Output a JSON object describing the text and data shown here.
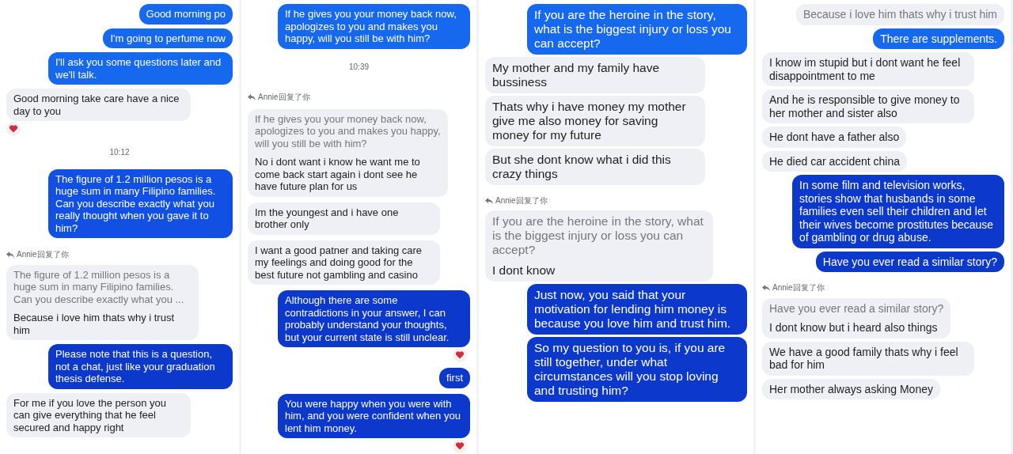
{
  "columns": [
    {
      "messages": [
        {
          "kind": "sent",
          "text": "Good morning po",
          "color": "#1668ee",
          "reacted": false
        },
        {
          "kind": "sent",
          "text": "I'm going to perfume now",
          "color": "#1668ee",
          "reacted": false
        },
        {
          "kind": "sent",
          "text": "I'll ask you some questions later and we'll talk.",
          "color": "#1668ee",
          "reacted": false
        },
        {
          "kind": "received",
          "text": "Good morning take care have a nice day to you",
          "reacted": true
        },
        {
          "kind": "time",
          "text": "10:12"
        },
        {
          "kind": "sent",
          "text": "The figure of 1.2 million pesos is a huge sum in many Filipino families. Can you describe exactly what you really thought when you gave it to him?",
          "color": "#1250e4",
          "reacted": false
        },
        {
          "kind": "reply",
          "label": "Annie回复了你",
          "quote": "The figure of 1.2 million pesos is a huge sum in many Filipino families. Can you describe exactly what you ...",
          "text": "Because i love him thats why i trust him"
        },
        {
          "kind": "sent",
          "text": "Please note that this is a question, not a chat, just like your graduation thesis defense.",
          "color": "#0c38cc",
          "reacted": false
        },
        {
          "kind": "received",
          "text": "For me if you love the person you can give everything that he feel secured and happy right",
          "reacted": false
        }
      ]
    },
    {
      "messages": [
        {
          "kind": "sent",
          "text": "If he gives you your money back now, apologizes to you and makes you happy, will you still be with him?",
          "color": "#1668ee",
          "reacted": false
        },
        {
          "kind": "time",
          "text": "10:39"
        },
        {
          "kind": "reply",
          "label": "Annie回复了你",
          "quote": "If he gives you your money back now, apologizes to you and makes you happy, will you still be with him?",
          "text": "No i dont want i know he want me to come back start again i dont see he have future plan for us"
        },
        {
          "kind": "received",
          "text": "Im the youngest and i have one brother only",
          "reacted": false
        },
        {
          "kind": "received",
          "text": "I want a good patner and taking care my feelings and doing good for the best future not gambling and casino",
          "reacted": false
        },
        {
          "kind": "sent",
          "text": "Although there are some contradictions in your answer, I can probably understand your thoughts, but your current state is still unclear.",
          "color": "#0c38cc",
          "reacted": true
        },
        {
          "kind": "sent",
          "text": "first",
          "color": "#0c38cc",
          "reacted": false
        },
        {
          "kind": "sent",
          "text": "You were happy when you were with him, and you were confident when you lent him money.",
          "color": "#0c38cc",
          "reacted": true
        }
      ]
    },
    {
      "messages": [
        {
          "kind": "sent",
          "text": "If you are the heroine in the story, what is the biggest injury or loss you can accept?",
          "color": "#1668ee",
          "reacted": false
        },
        {
          "kind": "received",
          "text": "My mother and my family have bussiness",
          "reacted": false
        },
        {
          "kind": "received",
          "text": "Thats why i have money my mother give me also money for saving money for my future",
          "reacted": false
        },
        {
          "kind": "received",
          "text": "But she dont know what i did this crazy things",
          "reacted": false
        },
        {
          "kind": "reply",
          "label": "Annie回复了你",
          "quote": "If you are the heroine in the story, what is the biggest injury or loss you can accept?",
          "text": "I dont know"
        },
        {
          "kind": "sent",
          "text": "Just now, you said that your motivation for lending him money is because you love him and trust him.",
          "color": "#0c38cc",
          "reacted": false
        },
        {
          "kind": "sent",
          "text": "So my question to you is, if you are still together, under what circumstances will you stop loving and trusting him?",
          "color": "#0c38cc",
          "reacted": false
        }
      ]
    },
    {
      "messages": [
        {
          "kind": "quote",
          "text": "Because i love him thats why i trust him"
        },
        {
          "kind": "sent",
          "text": "There are supplements.",
          "color": "#1668ee",
          "reacted": false
        },
        {
          "kind": "received",
          "text": "I know im stupid but i dont want he feel disappointment to me",
          "reacted": false
        },
        {
          "kind": "received",
          "text": "And he is responsible to give money to her mother and sister also",
          "reacted": false
        },
        {
          "kind": "received",
          "text": "He dont have a father also",
          "reacted": false
        },
        {
          "kind": "received",
          "text": "He died car accident china",
          "reacted": false
        },
        {
          "kind": "sent",
          "text": "In some film and television works, stories show that husbands in some families even sell their children and let their wives become prostitutes because of gambling or drug abuse.",
          "color": "#0c38cc",
          "reacted": false
        },
        {
          "kind": "sent",
          "text": "Have you ever read a similar story?",
          "color": "#0c38cc",
          "reacted": false
        },
        {
          "kind": "reply",
          "label": "Annie回复了你",
          "quote": "Have you ever read a similar story?",
          "text": "I dont know but i heard also things"
        },
        {
          "kind": "received",
          "text": "We have a good family thats why i feel bad for him",
          "reacted": false
        },
        {
          "kind": "received",
          "text": "Her mother always asking Money",
          "reacted": false
        }
      ]
    }
  ]
}
